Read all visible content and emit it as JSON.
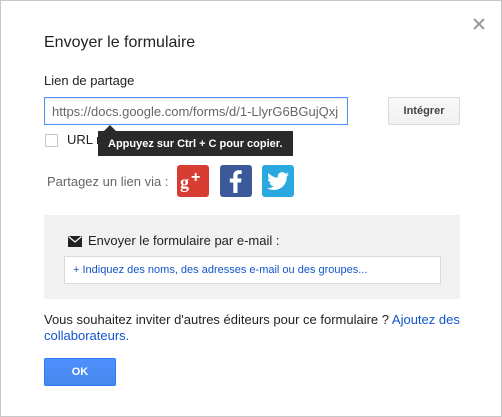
{
  "dialog": {
    "title": "Envoyer le formulaire",
    "close_icon": "close-icon"
  },
  "share": {
    "label": "Lien de partage",
    "link_value": "https://docs.google.com/forms/d/1-LlyrG6BGujQxj",
    "embed_label": "Intégrer",
    "short_url_label": "URL r",
    "short_url_checked": false,
    "tooltip": "Appuyez sur Ctrl + C pour copier."
  },
  "social": {
    "label": "Partagez un lien via :",
    "networks": [
      {
        "name": "Google+",
        "icon": "google-plus-icon",
        "color": "#d73d32"
      },
      {
        "name": "Facebook",
        "icon": "facebook-icon",
        "color": "#3b5998"
      },
      {
        "name": "Twitter",
        "icon": "twitter-icon",
        "color": "#2aa9e0"
      }
    ]
  },
  "email": {
    "title": "Envoyer le formulaire par e-mail :",
    "icon": "envelope-icon",
    "placeholder": "+ Indiquez des noms, des adresses e-mail ou des groupes..."
  },
  "invite": {
    "text": "Vous souhaitez inviter d'autres éditeurs pour ce formulaire ? ",
    "link": "Ajoutez des collaborateurs."
  },
  "footer": {
    "ok_label": "OK"
  },
  "colors": {
    "accent": "#4d90fe",
    "link": "#1155cc",
    "tooltip_bg": "#2a2a2a"
  }
}
